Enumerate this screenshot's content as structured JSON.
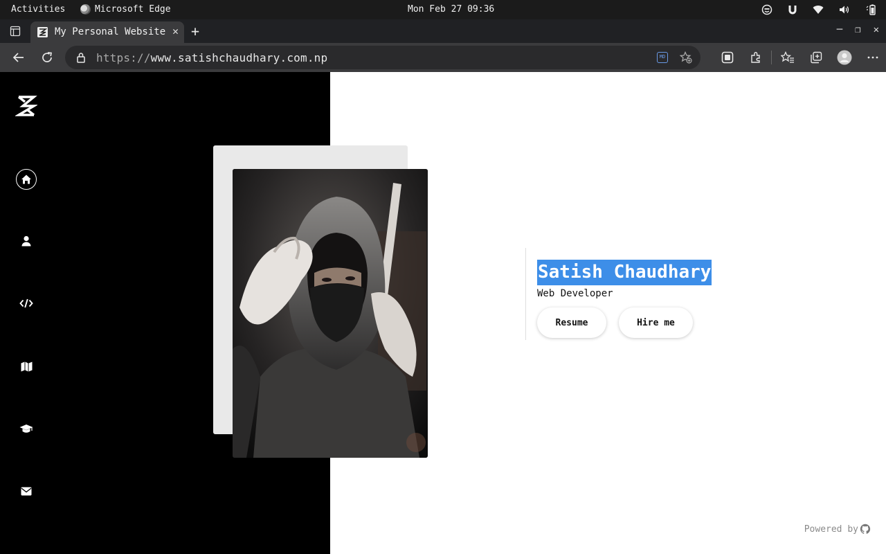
{
  "system": {
    "activities": "Activities",
    "app_name": "Microsoft Edge",
    "clock": "Mon Feb 27  09:36"
  },
  "browser": {
    "tab_title": "My Personal Website",
    "url_scheme": "https://",
    "url_host": "www.satishchaudhary.com.np",
    "badge": "MD"
  },
  "sidebar": {
    "items": [
      {
        "icon": "home-icon",
        "active": true
      },
      {
        "icon": "user-icon",
        "active": false
      },
      {
        "icon": "code-icon",
        "active": false
      },
      {
        "icon": "map-icon",
        "active": false
      },
      {
        "icon": "graduation-cap-icon",
        "active": false
      },
      {
        "icon": "envelope-icon",
        "active": false
      }
    ]
  },
  "hero": {
    "name": "Satish Chaudhary",
    "role": "Web Developer",
    "resume_label": "Resume",
    "hire_label": "Hire me"
  },
  "footer": {
    "powered_by": "Powered by"
  },
  "colors": {
    "selection": "#3d8ee8",
    "sidebar_bg": "#000000"
  }
}
